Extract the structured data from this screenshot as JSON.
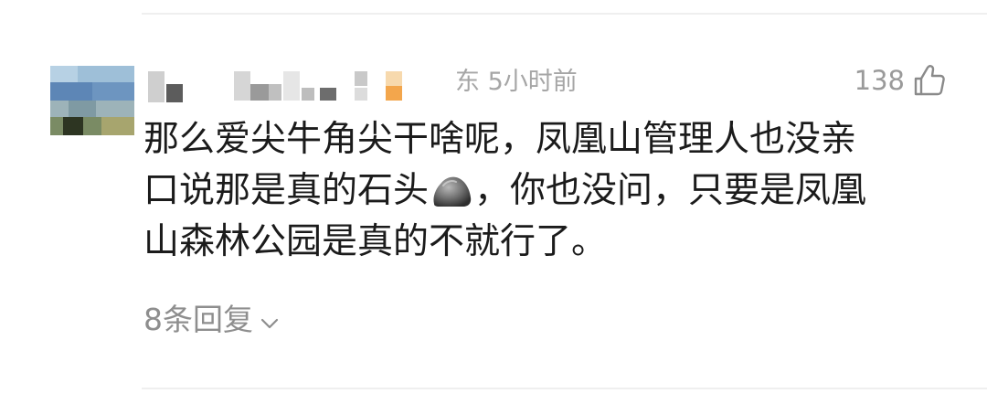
{
  "comment": {
    "location_time": "东 5小时前",
    "likes": "138",
    "text_lines": [
      "那么爱尖牛角尖干啥呢，凤凰山管理人也没亲",
      "口说那是真的石头",
      "，你也没问，只要是凤凰",
      "山森林公园是真的不就行了。"
    ],
    "emoji": "rock-emoji",
    "replies_label": "8条回复",
    "icons": {
      "like": "thumbs-up-icon",
      "expand": "chevron-down-icon"
    },
    "colors": {
      "text": "#1b1b1b",
      "meta": "#a6a6a6",
      "divider": "#efefef"
    }
  }
}
